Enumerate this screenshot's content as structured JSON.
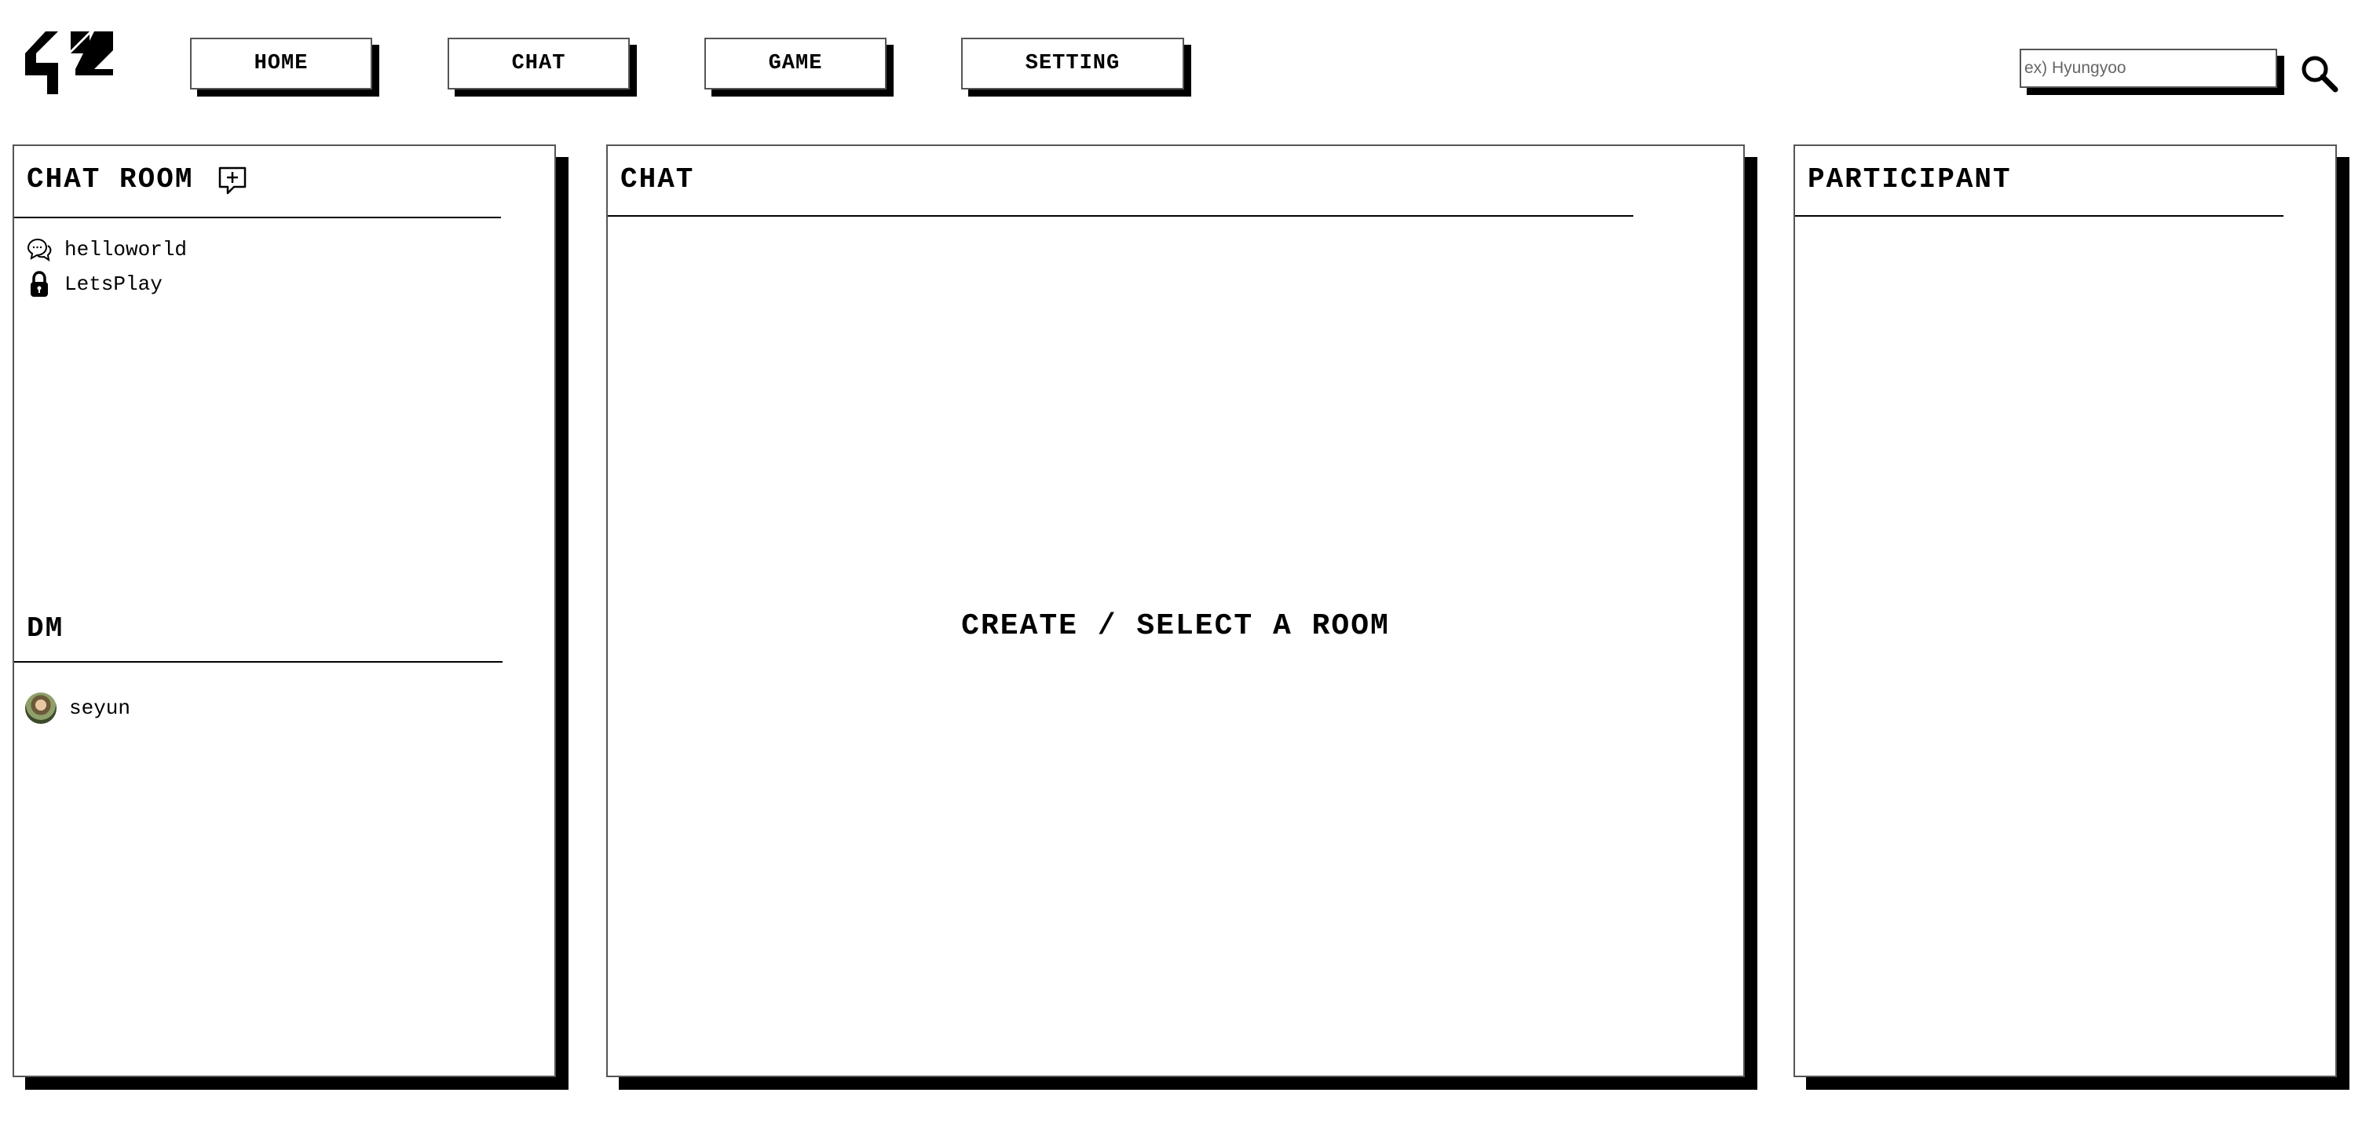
{
  "header": {
    "logo_icon": "42-logo-icon",
    "nav": {
      "home": "HOME",
      "chat": "CHAT",
      "game": "GAME",
      "setting": "SETTING"
    },
    "search": {
      "placeholder": "ex) Hyungyoo",
      "value": "",
      "icon": "search-icon"
    }
  },
  "left_panel": {
    "chat_room_title": "CHAT ROOM",
    "add_room_icon": "add-chat-icon",
    "rooms": [
      {
        "name": "helloworld",
        "icon": "chat-bubbles-icon"
      },
      {
        "name": "LetsPlay",
        "icon": "lock-icon"
      }
    ],
    "dm_title": "DM",
    "dms": [
      {
        "name": "seyun",
        "icon": "avatar"
      }
    ]
  },
  "center_panel": {
    "title": "CHAT",
    "empty_message": "CREATE / SELECT A ROOM"
  },
  "right_panel": {
    "title": "PARTICIPANT"
  },
  "colors": {
    "background": "#ffffff",
    "foreground": "#000000",
    "border": "#555555",
    "shadow": "#000000"
  }
}
